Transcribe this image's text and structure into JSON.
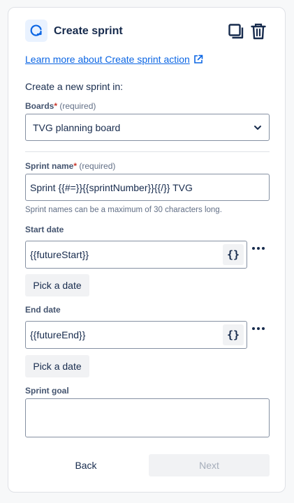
{
  "header": {
    "title": "Create sprint",
    "icon": "sprint-icon",
    "actions": [
      "copy-icon",
      "trash-icon"
    ]
  },
  "learn_more": {
    "label": "Learn more about Create sprint action",
    "icon": "external-link-icon"
  },
  "intro": "Create a new sprint in:",
  "boards": {
    "label": "Boards",
    "required_mark": "*",
    "required_text": "(required)",
    "value": "TVG planning board"
  },
  "sprint_name": {
    "label": "Sprint name",
    "required_mark": "*",
    "required_text": "(required)",
    "value": "Sprint {{#=}}{{sprintNumber}}{{/}} TVG",
    "helper": "Sprint names can be a maximum of 30 characters long."
  },
  "start_date": {
    "label": "Start date",
    "value": "{{futureStart}}",
    "braces": "{}",
    "pick_label": "Pick a date"
  },
  "end_date": {
    "label": "End date",
    "value": "{{futureEnd}}",
    "braces": "{}",
    "pick_label": "Pick a date"
  },
  "sprint_goal": {
    "label": "Sprint goal",
    "value": ""
  },
  "footer": {
    "back_label": "Back",
    "next_label": "Next"
  },
  "colors": {
    "link": "#0c66e4",
    "required": "#c9372c",
    "icon_bg": "#e9f2ff",
    "icon_fg": "#0c66e4",
    "border": "#8590a2",
    "button_bg": "#f1f2f4",
    "disabled_text": "#a5adba"
  }
}
